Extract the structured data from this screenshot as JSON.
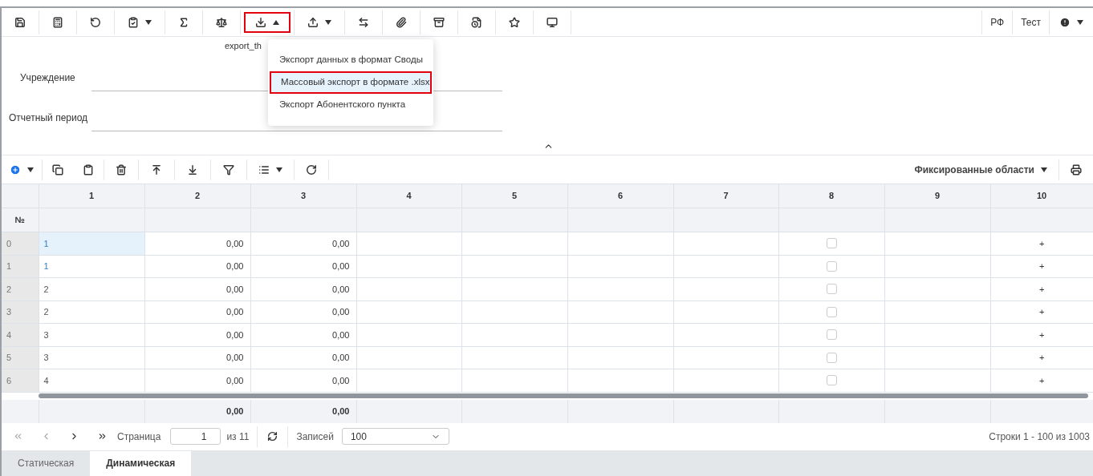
{
  "toolbar": {
    "right_labels": [
      "РФ",
      "Тест"
    ],
    "export_menu": {
      "open": true,
      "items": [
        {
          "label": "Экспорт данных в формат Своды",
          "selected": false
        },
        {
          "label": "Массовый экспорт в формате .xlsx",
          "selected": true
        },
        {
          "label": "Экспорт Абонентского пункта",
          "selected": false
        }
      ]
    }
  },
  "form": {
    "title": "export_th",
    "fields": [
      {
        "label": "Учреждение"
      },
      {
        "label": "Отчетный период"
      }
    ]
  },
  "grid_toolbar": {
    "fixed_areas": "Фиксированные области"
  },
  "grid": {
    "columns": [
      "1",
      "2",
      "3",
      "4",
      "5",
      "6",
      "7",
      "8",
      "9",
      "10"
    ],
    "row_header": "№",
    "rows": [
      {
        "num": "0",
        "c1": "1",
        "link": true,
        "c1_selected": true,
        "c2": "0,00",
        "c3": "0,00",
        "checked": false,
        "c10": "+"
      },
      {
        "num": "1",
        "c1": "1",
        "link": true,
        "c1_selected": false,
        "c2": "0,00",
        "c3": "0,00",
        "checked": false,
        "c10": "+"
      },
      {
        "num": "2",
        "c1": "2",
        "link": false,
        "c1_selected": false,
        "c2": "0,00",
        "c3": "0,00",
        "checked": false,
        "c10": "+"
      },
      {
        "num": "3",
        "c1": "2",
        "link": false,
        "c1_selected": false,
        "c2": "0,00",
        "c3": "0,00",
        "checked": false,
        "c10": "+"
      },
      {
        "num": "4",
        "c1": "3",
        "link": false,
        "c1_selected": false,
        "c2": "0,00",
        "c3": "0,00",
        "checked": false,
        "c10": "+"
      },
      {
        "num": "5",
        "c1": "3",
        "link": false,
        "c1_selected": false,
        "c2": "0,00",
        "c3": "0,00",
        "checked": false,
        "c10": "+"
      },
      {
        "num": "6",
        "c1": "4",
        "link": false,
        "c1_selected": false,
        "c2": "0,00",
        "c3": "0,00",
        "checked": false,
        "c10": "+"
      }
    ],
    "totals": {
      "c2": "0,00",
      "c3": "0,00"
    }
  },
  "pagination": {
    "page_label": "Страница",
    "page": "1",
    "of": "из 11",
    "records_label": "Записей",
    "records": "100",
    "summary": "Строки 1 - 100 из 1003"
  },
  "tabs": [
    {
      "label": "Статическая",
      "selected": false
    },
    {
      "label": "Динамическая",
      "selected": true
    }
  ]
}
